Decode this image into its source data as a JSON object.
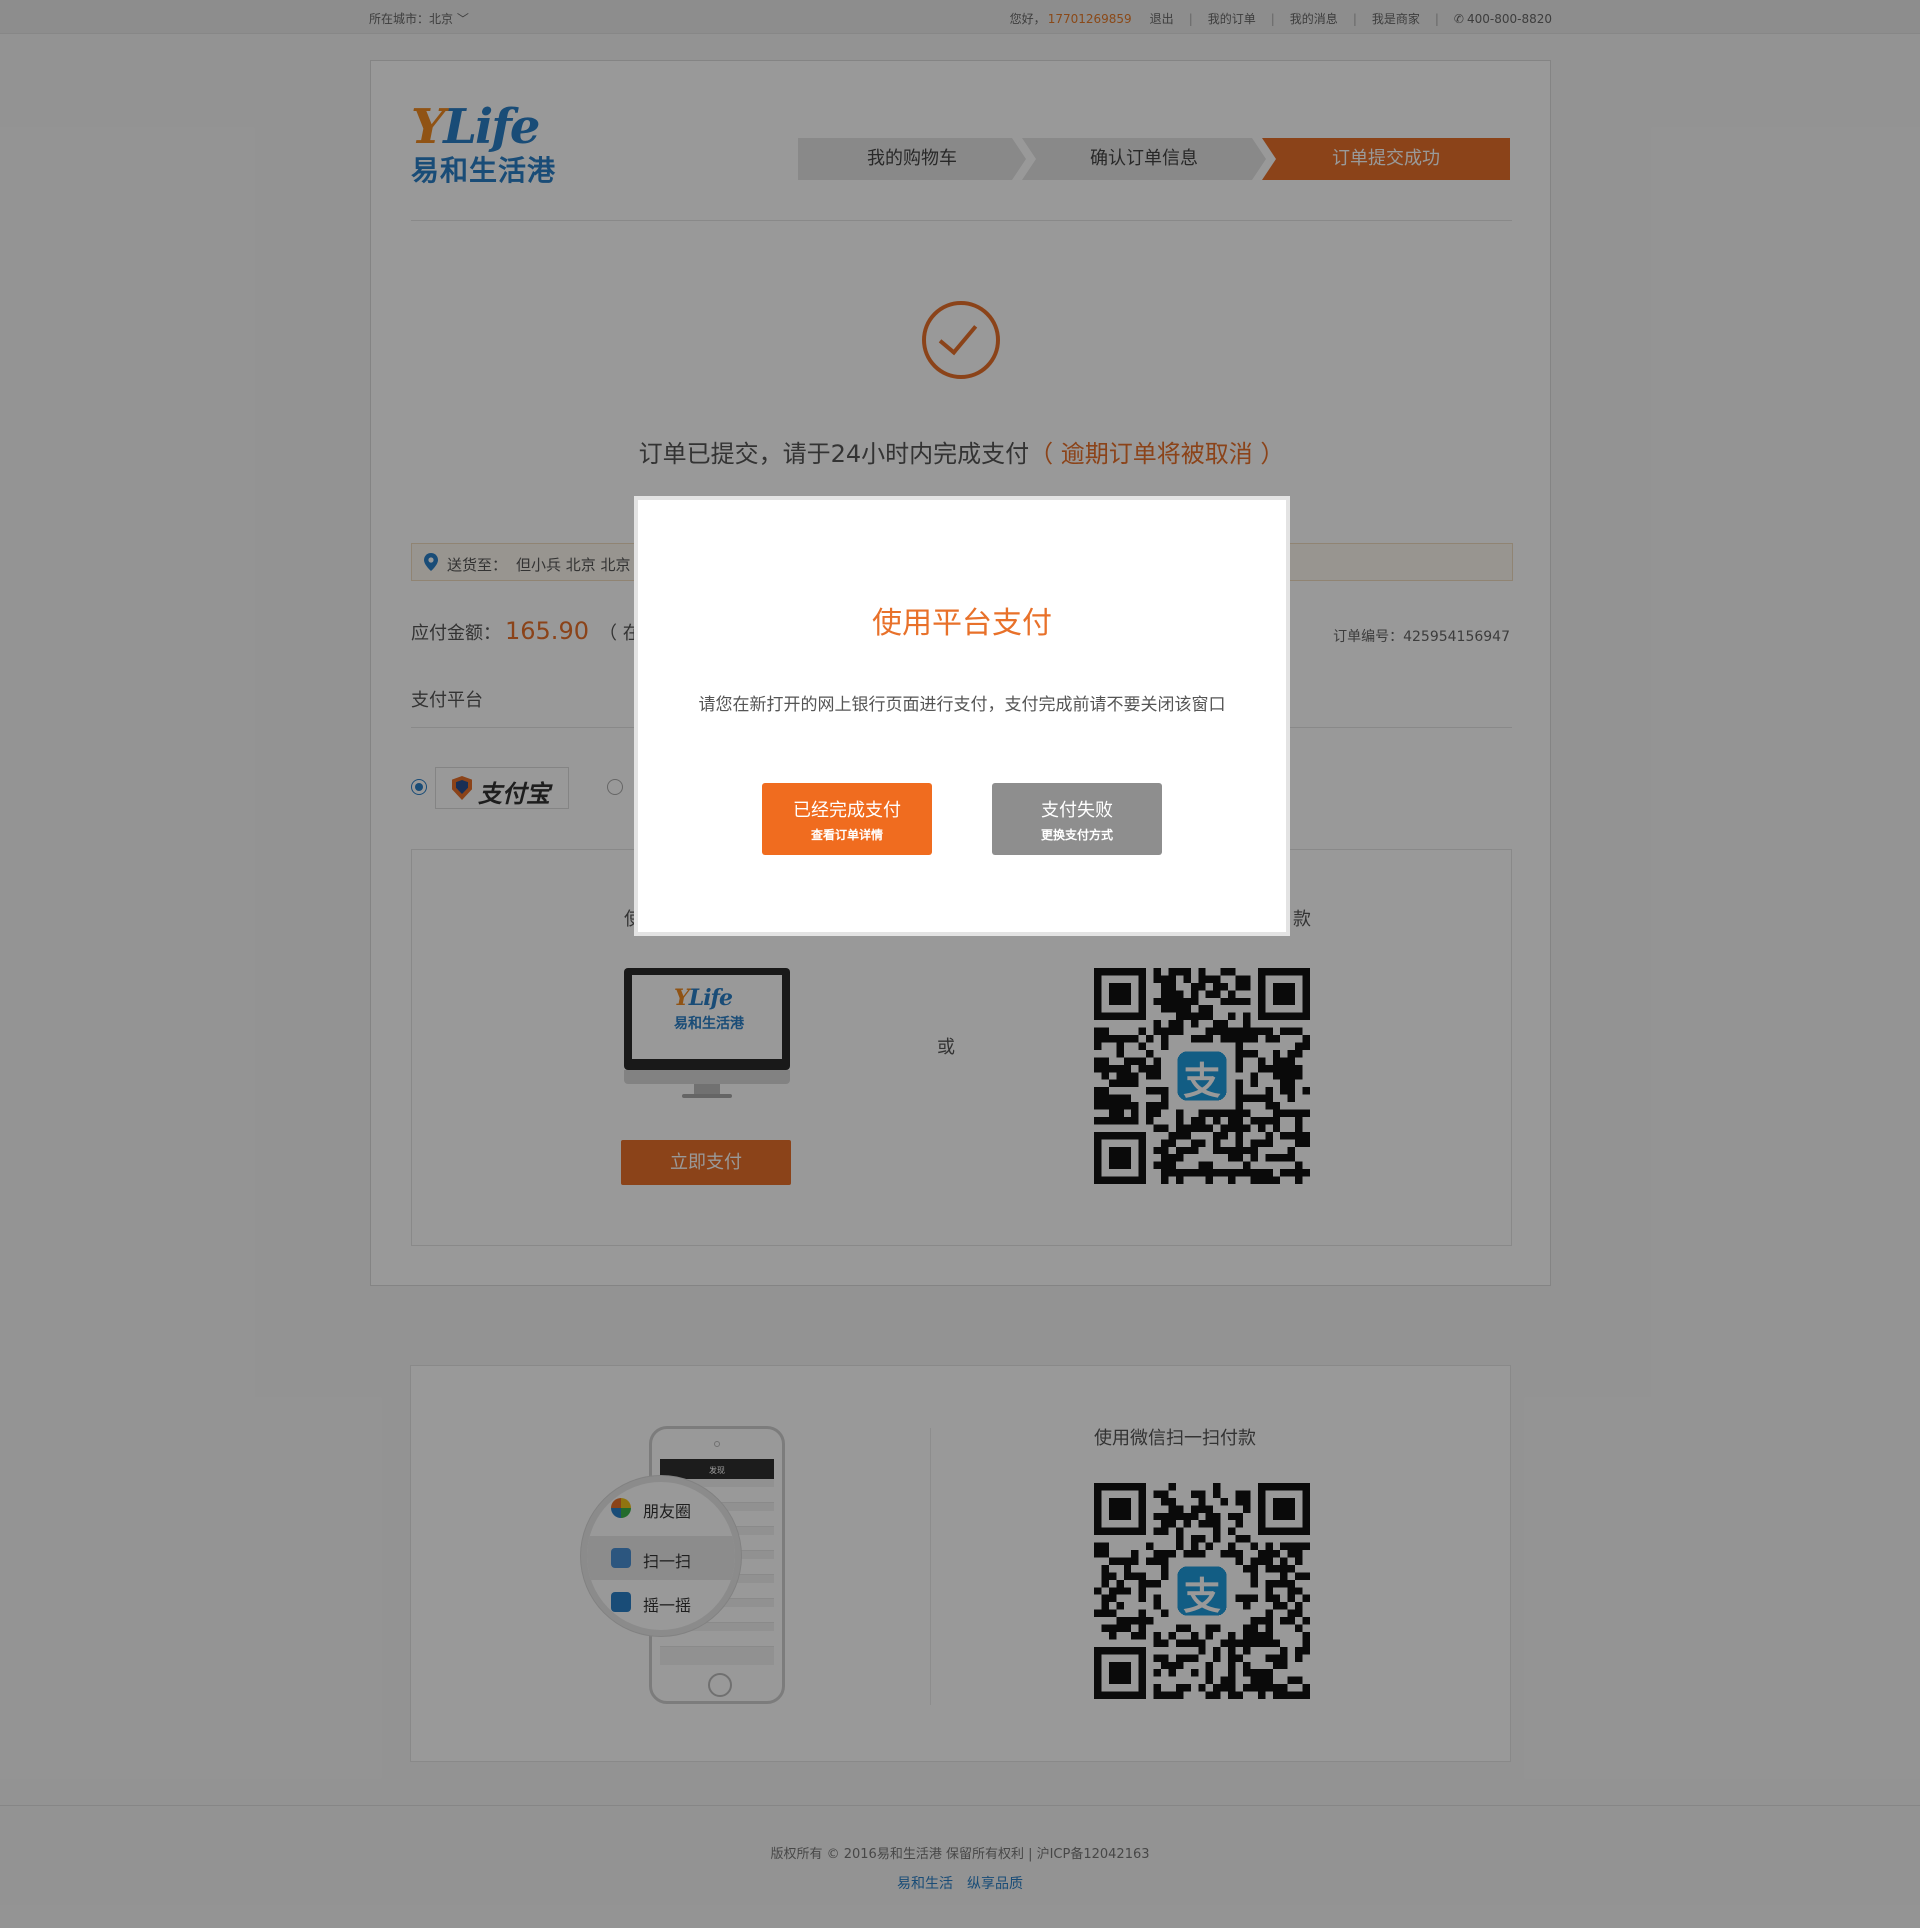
{
  "topbar": {
    "city_label": "所在城市：北京",
    "greeting": "您好，",
    "phone": "17701269859",
    "logout": "退出",
    "my_orders": "我的订单",
    "my_messages": "我的消息",
    "merchant": "我是商家",
    "service_phone": "400-800-8820"
  },
  "logo": {
    "en": "YLife",
    "cn": "易和生活港"
  },
  "steps": [
    "我的购物车",
    "确认订单信息",
    "订单提交成功"
  ],
  "success": {
    "message": "订单已提交，请于24小时内完成支付",
    "warning": "（ 逾期订单将被取消 ）"
  },
  "address": {
    "label": "送货至：",
    "value": "但小兵  北京  北京"
  },
  "payment": {
    "amount_label": "应付金额：",
    "amount": "165.90",
    "amount_note": "（ 在线",
    "order_no": "订单编号：425954156947",
    "platform_title": "支付平台",
    "alipay_label": "支付宝",
    "method_caption_left": "使",
    "method_caption_right": "款",
    "or": "或",
    "pay_now": "立即支付"
  },
  "monitor": {
    "logo_en": "YLife",
    "logo_cn": "易和生活港"
  },
  "wechat": {
    "caption": "使用微信扫一扫付款",
    "phone_header": "发现",
    "menu": [
      "朋友圈",
      "扫一扫",
      "摇一摇"
    ]
  },
  "footer": {
    "copyright": "版权所有 © 2016易和生活港   保留所有权利  |  沪ICP备12042163",
    "slogan_a": "易和生活",
    "slogan_b": "纵享品质"
  },
  "modal": {
    "title": "使用平台支付",
    "description": "请您在新打开的网上银行页面进行支付，支付完成前请不要关闭该窗口",
    "done_line1": "已经完成支付",
    "done_line2": "查看订单详情",
    "fail_line1": "支付失败",
    "fail_line2": "更换支付方式"
  },
  "colors": {
    "accent": "#e8712a",
    "brand_blue": "#2a7fc6",
    "gray_button": "#8e8e8e"
  },
  "icons": [
    "location-pin-icon",
    "phone-icon",
    "chevron-down-icon",
    "check-circle-icon",
    "alipay-icon",
    "qr-code-icon"
  ]
}
